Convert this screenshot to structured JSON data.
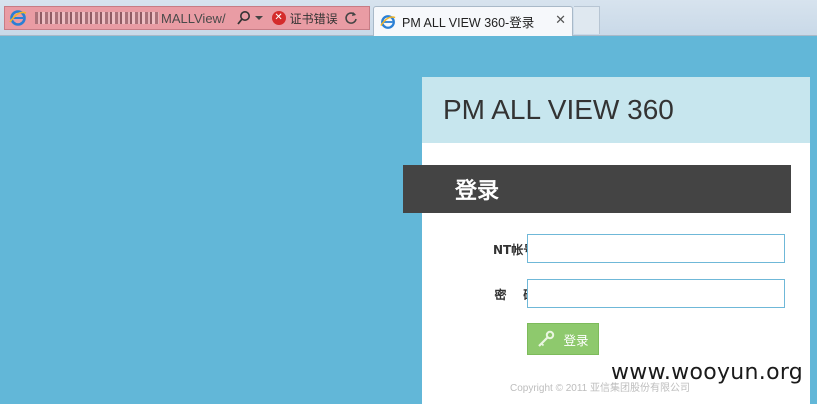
{
  "browser": {
    "address_text": "MALLView/",
    "cert_error": "证书错误",
    "tab_title": "PM ALL VIEW 360-登录",
    "tab_close": "✕"
  },
  "panel": {
    "header": "PM ALL VIEW 360",
    "banner": "登录",
    "account_label": "NT帐号:",
    "account_value": "",
    "password_label": "密    码:",
    "password_value": "",
    "login_button": "登录",
    "copyright": "Copyright © 2011 亚信集团股份有限公司"
  },
  "watermark": "www.wooyun.org",
  "colors": {
    "page_bg": "#62b7d8",
    "header_bg": "#c7e6ee",
    "banner_bg": "#444444",
    "button_bg": "#8ec96d",
    "address_error_bg": "#e99ca4"
  }
}
